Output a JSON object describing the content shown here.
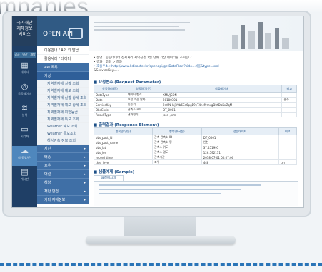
{
  "page_heading": "mpanies",
  "sidebar": {
    "logo_text": "국가재난\n재해정보\n서비스",
    "tabs": [
      "공공",
      "민간",
      "개방"
    ],
    "icons": [
      {
        "name": "grid-icon",
        "glyph": "▦",
        "label": "데이터"
      },
      {
        "name": "globe-icon",
        "glyph": "◎",
        "label": "공공데이터"
      },
      {
        "name": "layers-icon",
        "glyph": "≋",
        "label": "분석"
      },
      {
        "name": "monitor-icon",
        "glyph": "▭",
        "label": "시각화"
      },
      {
        "name": "cloud-icon",
        "glyph": "☁",
        "label": "OPEN API"
      },
      {
        "name": "doc-icon",
        "glyph": "▤",
        "label": "게시판"
      }
    ]
  },
  "nav": {
    "title": "OPEN API",
    "items": [
      {
        "label": "이용안내 / API 키 발급",
        "style": "plain"
      },
      {
        "label": "활용사례 / 데이터",
        "style": "plain"
      },
      {
        "label": "API 목록",
        "style": "blue"
      },
      {
        "label": "기상",
        "style": "dark"
      },
      {
        "label": "지역별재해 실황 조회",
        "style": "sub"
      },
      {
        "label": "지역별재해 예보 조회",
        "style": "sub"
      },
      {
        "label": "지역별재해 실황 상세 조회",
        "style": "sub"
      },
      {
        "label": "지역별재해 예보 상세 조회",
        "style": "sub"
      },
      {
        "label": "지역별재해 위험등급",
        "style": "sub"
      },
      {
        "label": "지역별재해 특보 조회",
        "style": "sub"
      },
      {
        "label": "Weather 예보 조회",
        "style": "sub"
      },
      {
        "label": "Weather 특보조회",
        "style": "sub"
      },
      {
        "label": "해상관측 정보 조회",
        "style": "sub"
      },
      {
        "label": "지진",
        "style": "blue"
      },
      {
        "label": "태풍",
        "style": "blue"
      },
      {
        "label": "호우",
        "style": "blue"
      },
      {
        "label": "대설",
        "style": "blue"
      },
      {
        "label": "해양",
        "style": "blue"
      },
      {
        "label": "재난 안전",
        "style": "blue"
      },
      {
        "label": "기타 재해정보",
        "style": "blue"
      }
    ]
  },
  "content": {
    "service_lines": [
      "• 설명      : 공공데이터 정제처리 지역진흥 1일 단위 기상 데이터를 조회한다.",
      "• 결과      : 조회 > 결과",
      "• 호출주소   : http://www.kdisaster.kr/openapi/getDataFlow?sido=서울&type=xml",
      "                 &ServiceKey=..."
    ],
    "request_title": "■ 요청변수 (Request Parameter)",
    "request_headers": [
      "항목명(영문)",
      "항목명(국문)",
      "샘플데이터",
      "비고"
    ],
    "request_rows": [
      [
        "DataType",
        "데이터 형식",
        "XML/JSON",
        ""
      ],
      [
        "Date",
        "요청 기준 날짜",
        "20180701",
        "필수"
      ],
      [
        "ServiceKey",
        "인증키",
        "2rdfNHxjV9b6Ed6pgE9yT4nM9mxgDlrtDbKxZqM",
        ""
      ],
      [
        "ObsCode",
        "관측소 코드",
        "DT_0001",
        ""
      ],
      [
        "ResultType",
        "결과형식",
        "json , xml",
        ""
      ]
    ],
    "response_title": "■ 출력결과 (Response Element)",
    "response_headers": [
      "항목명(영문)",
      "항목명(국문)",
      "샘플데이터",
      "비고"
    ],
    "response_rows": [
      [
        "obs_post_id",
        "관측 관측소 ID",
        "DT_0001",
        ""
      ],
      [
        "obs_post_name",
        "관측 관측소 명",
        "인천",
        ""
      ],
      [
        "obs_lat",
        "관측소 위도",
        "37.451995",
        ""
      ],
      [
        "obs_lon",
        "관측소 경도",
        "126.592111",
        ""
      ],
      [
        "record_time",
        "관측시간",
        "2018-07-01 00:07:00",
        ""
      ],
      [
        "tide_level",
        "조위",
        "448",
        "cm"
      ]
    ],
    "sample_title": "■ 샘플예제 (Sample)",
    "sample_tab": "요청메시지"
  }
}
